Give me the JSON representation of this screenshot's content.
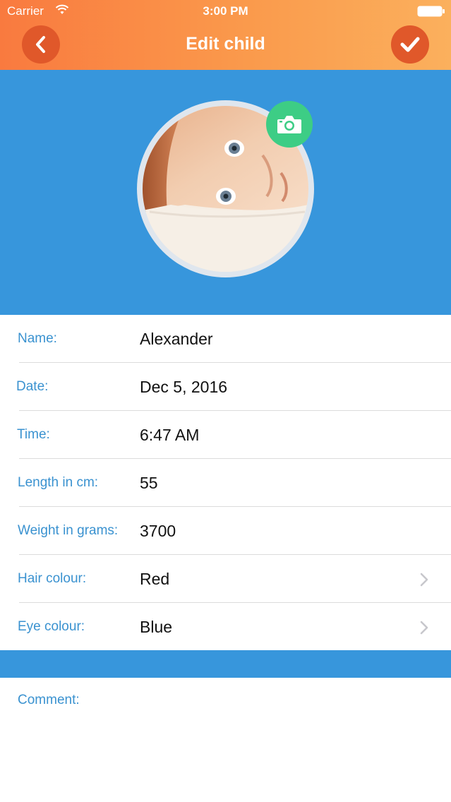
{
  "status_bar": {
    "carrier": "Carrier",
    "time": "3:00 PM"
  },
  "header": {
    "title": "Edit child",
    "back_icon": "chevron-left-icon",
    "confirm_icon": "checkmark-icon"
  },
  "photo": {
    "camera_icon": "camera-icon"
  },
  "form": {
    "rows": [
      {
        "label": "Name:",
        "value": "Alexander"
      },
      {
        "label": "Date:",
        "value": "Dec 5, 2016"
      },
      {
        "label": "Time:",
        "value": "6:47 AM"
      },
      {
        "label": "Length in cm:",
        "value": "55"
      },
      {
        "label": "Weight in grams:",
        "value": "3700"
      },
      {
        "label": "Hair colour:",
        "value": "Red"
      },
      {
        "label": "Eye colour:",
        "value": "Blue"
      }
    ]
  },
  "comment": {
    "label": "Comment:"
  },
  "colors": {
    "header_start": "#f97a3f",
    "header_end": "#fbb05d",
    "photo_background": "#3796dc",
    "label_blue": "#3a92d0",
    "camera_green": "#3dcd85",
    "button_orange": "#e0582a"
  }
}
